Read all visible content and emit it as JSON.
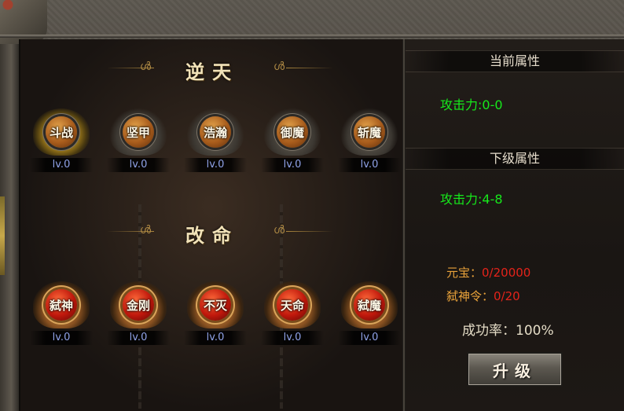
{
  "sections": {
    "nitian": {
      "title": "逆天",
      "skills": [
        {
          "name": "斗战",
          "level": "lv.0",
          "active": true
        },
        {
          "name": "坚甲",
          "level": "lv.0",
          "active": false
        },
        {
          "name": "浩瀚",
          "level": "lv.0",
          "active": false
        },
        {
          "name": "御魔",
          "level": "lv.0",
          "active": false
        },
        {
          "name": "斩魔",
          "level": "lv.0",
          "active": false
        }
      ]
    },
    "gaiming": {
      "title": "改命",
      "skills": [
        {
          "name": "弑神",
          "level": "lv.0"
        },
        {
          "name": "金刚",
          "level": "lv.0"
        },
        {
          "name": "不灭",
          "level": "lv.0"
        },
        {
          "name": "天命",
          "level": "lv.0"
        },
        {
          "name": "弑魔",
          "level": "lv.0"
        }
      ]
    }
  },
  "attributes": {
    "current_header": "当前属性",
    "current_value": "攻击力:0-0",
    "next_header": "下级属性",
    "next_value": "攻击力:4-8"
  },
  "costs": {
    "yuanbao_label": "元宝：",
    "yuanbao_value": "0/20000",
    "token_label": "弑神令：",
    "token_value": "0/20"
  },
  "success_rate": "成功率：100%",
  "upgrade_label": "升级",
  "colors": {
    "attr_green": "#16e91b",
    "cost_label_orange": "#e9a23a",
    "cost_value_red": "#e4231a",
    "level_blue": "#8fa2e8",
    "title_gold": "#f1e2b8"
  }
}
